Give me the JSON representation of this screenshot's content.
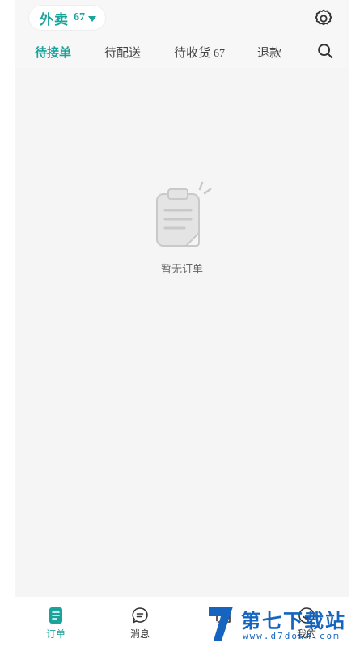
{
  "header": {
    "mode_label": "外卖",
    "mode_count": "67"
  },
  "tabs": [
    {
      "label": "待接单",
      "count": "",
      "active": true
    },
    {
      "label": "待配送",
      "count": ""
    },
    {
      "label": "待收货",
      "count": "67"
    },
    {
      "label": "退款",
      "count": ""
    }
  ],
  "empty_state": {
    "message": "暂无订单"
  },
  "bottom_nav": [
    {
      "label": "订单",
      "icon": "orders-icon",
      "active": true
    },
    {
      "label": "消息",
      "icon": "message-icon"
    },
    {
      "label": "",
      "icon": "shop-icon"
    },
    {
      "label": "我的",
      "icon": "profile-icon"
    }
  ],
  "watermark": {
    "title": "第七下载站",
    "url": "www.d7down.com"
  },
  "colors": {
    "accent": "#1aa39a",
    "background": "#f5f5f5",
    "watermark": "#1565c0"
  }
}
